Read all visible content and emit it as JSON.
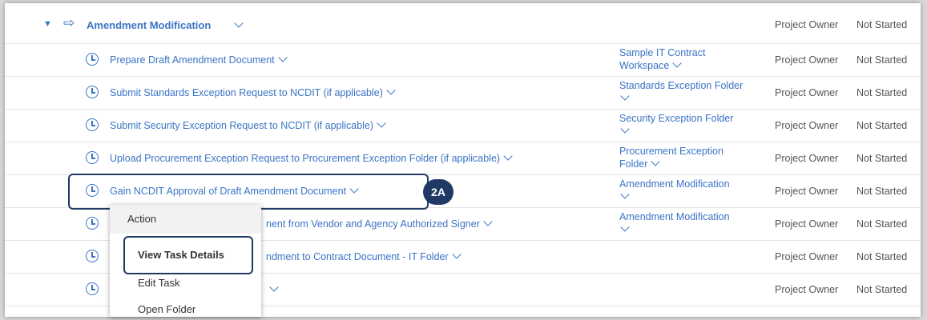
{
  "header": {
    "title": "Amendment Modification",
    "owner": "Project Owner",
    "status": "Not Started"
  },
  "tasks": [
    {
      "title": "Prepare Draft Amendment Document",
      "folder_line1": "Sample IT Contract",
      "folder_line2": "Workspace",
      "owner": "Project Owner",
      "status": "Not Started"
    },
    {
      "title": "Submit Standards Exception Request to NCDIT (if applicable)",
      "folder_line1": "Standards Exception Folder",
      "folder_line2": "",
      "owner": "Project Owner",
      "status": "Not Started"
    },
    {
      "title": "Submit Security Exception Request to NCDIT (if applicable)",
      "folder_line1": "Security Exception Folder",
      "folder_line2": "",
      "owner": "Project Owner",
      "status": "Not Started"
    },
    {
      "title": "Upload Procurement Exception Request to Procurement Exception Folder (if applicable)",
      "folder_line1": "Procurement Exception",
      "folder_line2": "Folder",
      "owner": "Project Owner",
      "status": "Not Started"
    },
    {
      "title": "Gain NCDIT Approval of Draft Amendment Document",
      "folder_line1": "Amendment Modification",
      "folder_line2": "",
      "owner": "Project Owner",
      "status": "Not Started"
    },
    {
      "title": "nent from Vendor and Agency Authorized Signer",
      "folder_line1": "Amendment Modification",
      "folder_line2": "",
      "owner": "Project Owner",
      "status": "Not Started"
    },
    {
      "title": "ndment to Contract Document - IT Folder",
      "folder_line1": "",
      "folder_line2": "",
      "owner": "Project Owner",
      "status": "Not Started"
    },
    {
      "title": "",
      "folder_line1": "",
      "folder_line2": "",
      "owner": "Project Owner",
      "status": "Not Started"
    }
  ],
  "callout": {
    "badge": "2A"
  },
  "menu": {
    "header": "Action",
    "items": [
      "View Task Details",
      "Edit Task",
      "Open Folder"
    ]
  },
  "icons": [
    "expand-triangle-icon",
    "arrow-right-icon",
    "clock-icon",
    "chevron-down-icon"
  ],
  "colors": {
    "link": "#3b74c4",
    "callout": "#1f3a64"
  }
}
